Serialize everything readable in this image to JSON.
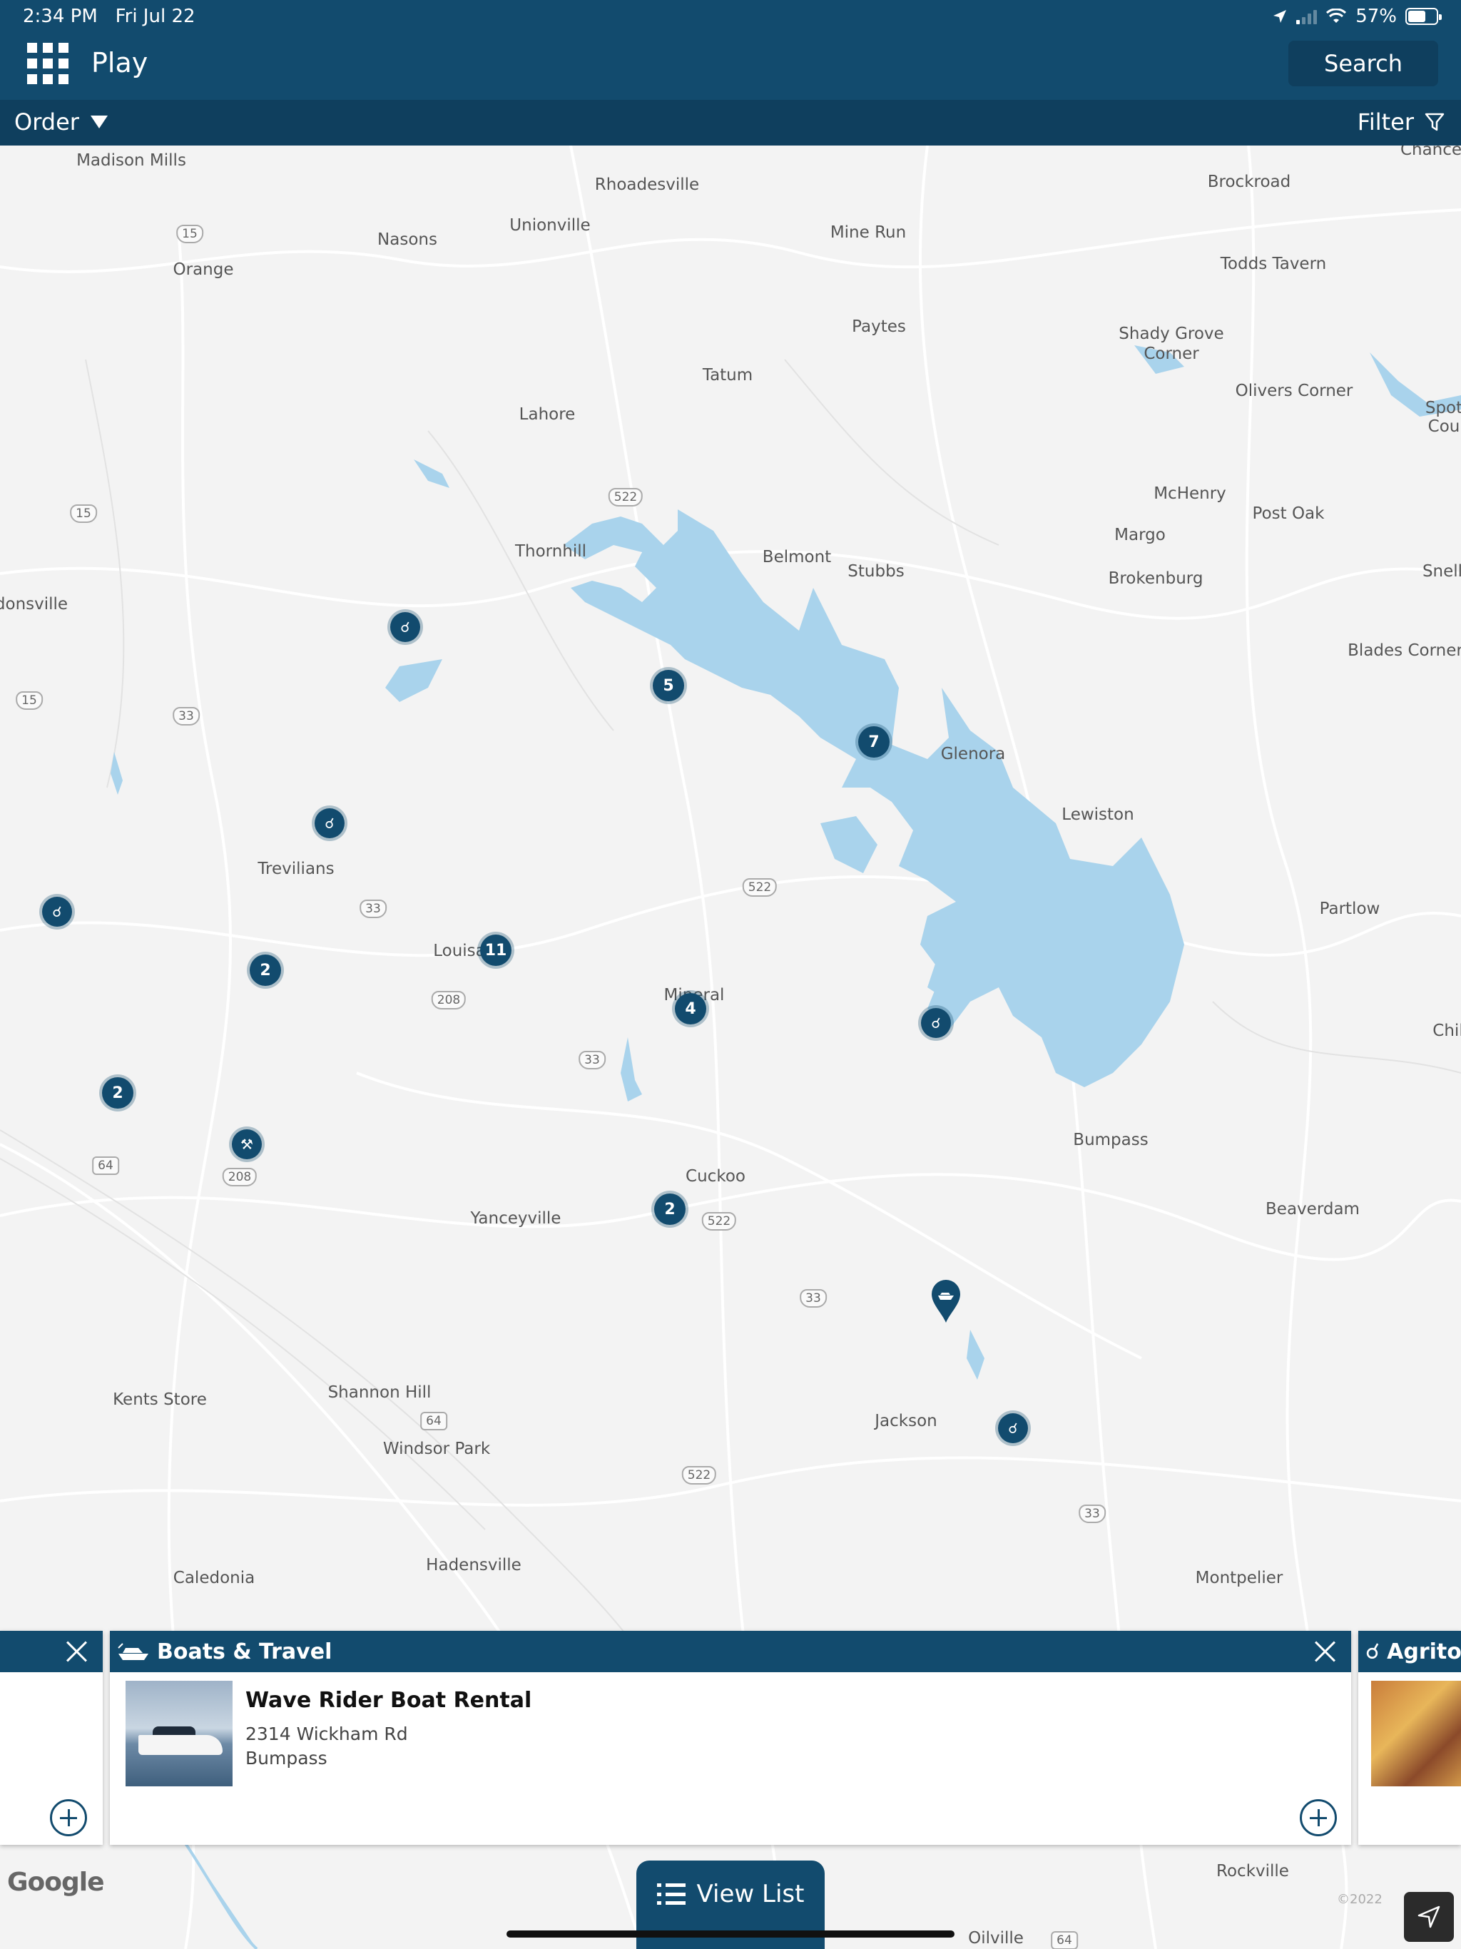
{
  "status_bar": {
    "time": "2:34 PM",
    "date": "Fri Jul 22",
    "battery": "57%"
  },
  "header": {
    "title": "Play",
    "search_label": "Search"
  },
  "subbar": {
    "order_label": "Order",
    "filter_label": "Filter"
  },
  "map": {
    "places": [
      "Madison Mills",
      "Rhoadesville",
      "Unionville",
      "Nasons",
      "Orange",
      "Mine Run",
      "Brockroad",
      "Todds Tavern",
      "Paytes",
      "Tatum",
      "Shady Grove\nCorner",
      "Olivers Corner",
      "Lahore",
      "McHenry",
      "Post Oak",
      "Margo",
      "Thornhill",
      "Belmont",
      "Stubbs",
      "Brokenburg",
      "donsville",
      "Snell",
      "Blades Corner",
      "Glenora",
      "Lewiston",
      "Trevilians",
      "Partlow",
      "Louisa",
      "Mineral",
      "Chil",
      "Bumpass",
      "Cuckoo",
      "Yanceyville",
      "Beaverdam",
      "Kents Store",
      "Shannon Hill",
      "Jackson",
      "Windsor Park",
      "Caledonia",
      "Hadensville",
      "Montpelier",
      "Rockville",
      "Oilville",
      "Chance",
      "Spot\nCou"
    ],
    "route_shields": [
      "15",
      "15",
      "15",
      "522",
      "33",
      "33",
      "522",
      "208",
      "33",
      "64",
      "208",
      "522",
      "33",
      "64",
      "522",
      "33",
      "64"
    ],
    "clusters": [
      "5",
      "7",
      "11",
      "2",
      "4",
      "2",
      "2"
    ]
  },
  "cards": {
    "left": {
      "partial": true
    },
    "main": {
      "category": "Boats & Travel",
      "name": "Wave Rider Boat Rental",
      "address_line1": "2314 Wickham Rd",
      "address_line2": "Bumpass"
    },
    "right": {
      "category": "Agrito"
    }
  },
  "bottom": {
    "view_list_label": "View List",
    "google_logo": "Google",
    "copyright": "©2022"
  },
  "colors": {
    "brand": "#124b6e",
    "brand_dark": "#0f3f5e",
    "water": "#a9d3ec",
    "map_bg": "#f3f3f3"
  }
}
